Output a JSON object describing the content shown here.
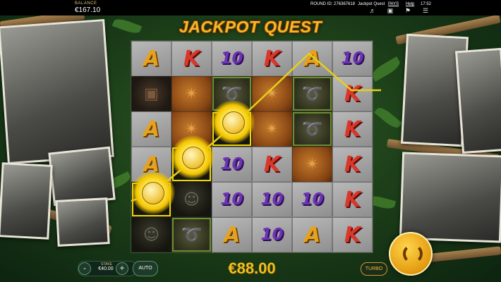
{
  "topbar": {
    "balance_label": "BALANCE",
    "balance_value": "€167.10",
    "round": "ROUND ID: 276367618",
    "game_name": "Jackpot Quest",
    "pays_label": "PAYS",
    "help_label": "Help",
    "time": "17:52",
    "icons": [
      "mute-icon",
      "fullscreen-icon",
      "notification-icon",
      "menu-icon"
    ]
  },
  "title": "JACKPOT QUEST",
  "grid": {
    "rows": [
      [
        "A",
        "K",
        "10",
        "K",
        "A",
        "10"
      ],
      [
        "bag",
        "map",
        "whip",
        "map",
        "whip",
        "K"
      ],
      [
        "A",
        "map",
        "coin",
        "map",
        "whip",
        "K"
      ],
      [
        "A",
        "coin",
        "10",
        "K",
        "map",
        "K"
      ],
      [
        "coin",
        "hero",
        "10",
        "10",
        "10",
        "K"
      ],
      [
        "hero",
        "whip",
        "A",
        "10",
        "A",
        "K"
      ]
    ],
    "win_line": "coin-payline"
  },
  "controls": {
    "minus": "-",
    "plus": "+",
    "stake_label": "STAKE",
    "stake_value": "€40.00",
    "auto_label": "AUTO",
    "win_amount": "€88.00",
    "turbo_label": "TURBO"
  },
  "colors": {
    "accent": "#f0c020",
    "letter_a": "#e5a21e",
    "letter_k": "#d9372b",
    "number_10": "#6c33b5"
  }
}
